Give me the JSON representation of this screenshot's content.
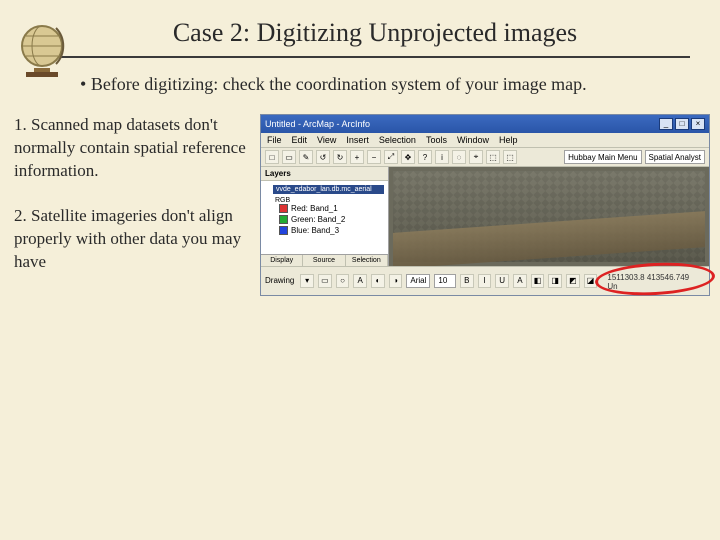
{
  "slide": {
    "title": "Case 2: Digitizing Unprojected images",
    "intro": "Before digitizing: check the coordination system of your image map.",
    "points": [
      {
        "num": "1.",
        "text": "Scanned map datasets don't normally contain spatial reference information."
      },
      {
        "num": "2.",
        "text": "Satellite imageries don't align properly with other data you may have"
      }
    ]
  },
  "app": {
    "title": "Untitled - ArcMap - ArcInfo",
    "window_buttons": {
      "min": "_",
      "max": "□",
      "close": "×"
    },
    "menu": [
      "File",
      "Edit",
      "View",
      "Insert",
      "Selection",
      "Tools",
      "Window",
      "Help"
    ],
    "toolbar": {
      "left_icons": [
        "□",
        "▭",
        "✎",
        "↺",
        "↻",
        "+",
        "−",
        "⤢",
        "✥",
        "?",
        "i",
        "◌",
        "⌖",
        "⬚",
        "⬚"
      ],
      "right_label_1": "Hubbay Main Menu",
      "right_label_2": "Spatial Analyst"
    },
    "toc": {
      "header": "Layers",
      "layer_group": "vvde_edabor_lan.db.mc_aerial",
      "rgb_label": "RGB",
      "bands": [
        {
          "color": "#d33",
          "label": "Red: Band_1"
        },
        {
          "color": "#2a3",
          "label": "Green: Band_2"
        },
        {
          "color": "#24d",
          "label": "Blue: Band_3"
        }
      ],
      "tabs": [
        "Display",
        "Source",
        "Selection"
      ]
    },
    "drawbar": {
      "label": "Drawing",
      "icons": [
        "▾",
        "▭",
        "○",
        "A",
        "◐",
        "◑"
      ],
      "font": "Arial",
      "size": "10",
      "style_icons": [
        "B",
        "I",
        "U",
        "A",
        "◧",
        "◨",
        "◩",
        "◪"
      ]
    },
    "status_coords": "1511303.8  413546.749 Un"
  }
}
